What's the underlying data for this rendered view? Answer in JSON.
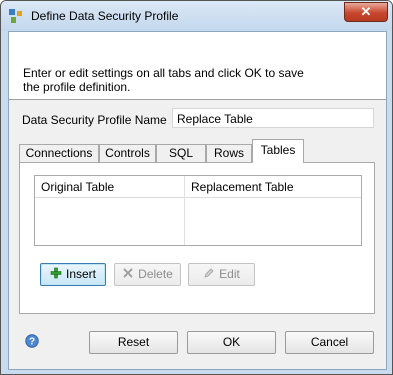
{
  "window": {
    "title": "Define Data Security Profile",
    "close_label": "✕"
  },
  "header": {
    "instructions": "Enter or edit settings on all tabs and click OK to save the profile definition."
  },
  "profile_name": {
    "label": "Data Security Profile Name",
    "value": "Replace Table"
  },
  "tabs": [
    {
      "label": "Connections",
      "active": false
    },
    {
      "label": "Controls",
      "active": false
    },
    {
      "label": "SQL",
      "active": false
    },
    {
      "label": "Rows",
      "active": false
    },
    {
      "label": "Tables",
      "active": true
    }
  ],
  "table": {
    "columns": [
      "Original Table",
      "Replacement Table"
    ],
    "rows": []
  },
  "table_buttons": {
    "insert": "Insert",
    "delete": "Delete",
    "edit": "Edit"
  },
  "footer": {
    "reset": "Reset",
    "ok": "OK",
    "cancel": "Cancel"
  },
  "colors": {
    "title_bar": "#c9dcef",
    "close_button": "#c7472e",
    "insert_icon": "#2e9e2e"
  }
}
